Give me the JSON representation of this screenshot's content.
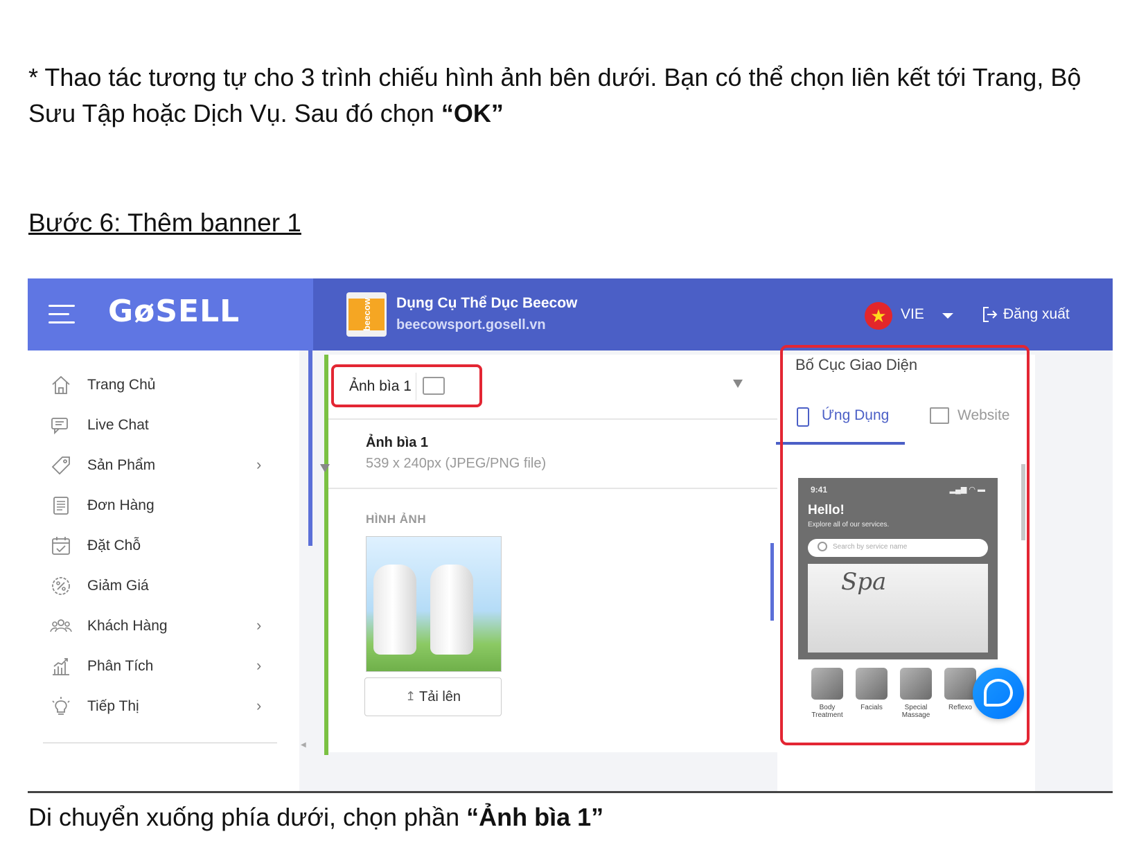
{
  "document": {
    "intro_prefix": "* Thao tác tương tự cho 3 trình chiếu hình ảnh bên dưới. Bạn có thể chọn liên kết tới Trang, Bộ Sưu Tập hoặc Dịch Vụ. Sau đó chọn ",
    "intro_bold": "“OK”",
    "step_title": "Bước 6: Thêm banner 1 ",
    "caption_prefix": "Di chuyển xuống phía dưới, chọn phần ",
    "caption_bold": "“Ảnh bìa 1”"
  },
  "header": {
    "logo": "GøSELL",
    "store_logo_text": "beecow",
    "store_name": "Dụng Cụ Thể Dục Beecow",
    "store_url": "beecowsport.gosell.vn",
    "language": "VIE",
    "logout_label": "Đăng xuất"
  },
  "sidebar": {
    "items": [
      {
        "label": "Trang Chủ",
        "icon": "home-icon"
      },
      {
        "label": "Live Chat",
        "icon": "chat-icon"
      },
      {
        "label": "Sản Phẩm",
        "icon": "tag-icon",
        "has_submenu": true
      },
      {
        "label": "Đơn Hàng",
        "icon": "document-icon"
      },
      {
        "label": "Đặt Chỗ",
        "icon": "calendar-check-icon"
      },
      {
        "label": "Giảm Giá",
        "icon": "discount-icon"
      },
      {
        "label": "Khách Hàng",
        "icon": "users-icon",
        "has_submenu": true
      },
      {
        "label": "Phân Tích",
        "icon": "analytics-icon",
        "has_submenu": true
      },
      {
        "label": "Tiếp Thị",
        "icon": "bulb-icon",
        "has_submenu": true
      }
    ]
  },
  "editor": {
    "section_label": "Ảnh bìa 1",
    "item_title": "Ảnh bìa 1",
    "item_subtitle": "539 x 240px (JPEG/PNG file)",
    "image_label": "HÌNH ẢNH",
    "upload_label": "Tải lên"
  },
  "preview": {
    "title": "Bố Cục Giao Diện",
    "tabs": [
      {
        "label": "Ứng Dụng",
        "active": true
      },
      {
        "label": "Website",
        "active": false
      }
    ],
    "phone": {
      "time": "9:41",
      "hello": "Hello!",
      "explore": "Explore all of our services.",
      "search_placeholder": "Search by service name",
      "banner_text": "Spa",
      "services": [
        "Body Treatment",
        "Facials",
        "Special Massage",
        "Reflexo"
      ]
    }
  },
  "colors": {
    "logo_bar": "#5f76e3",
    "top_bar": "#4b5fc6",
    "highlight": "#e32633",
    "accent_green": "#7bc143"
  }
}
